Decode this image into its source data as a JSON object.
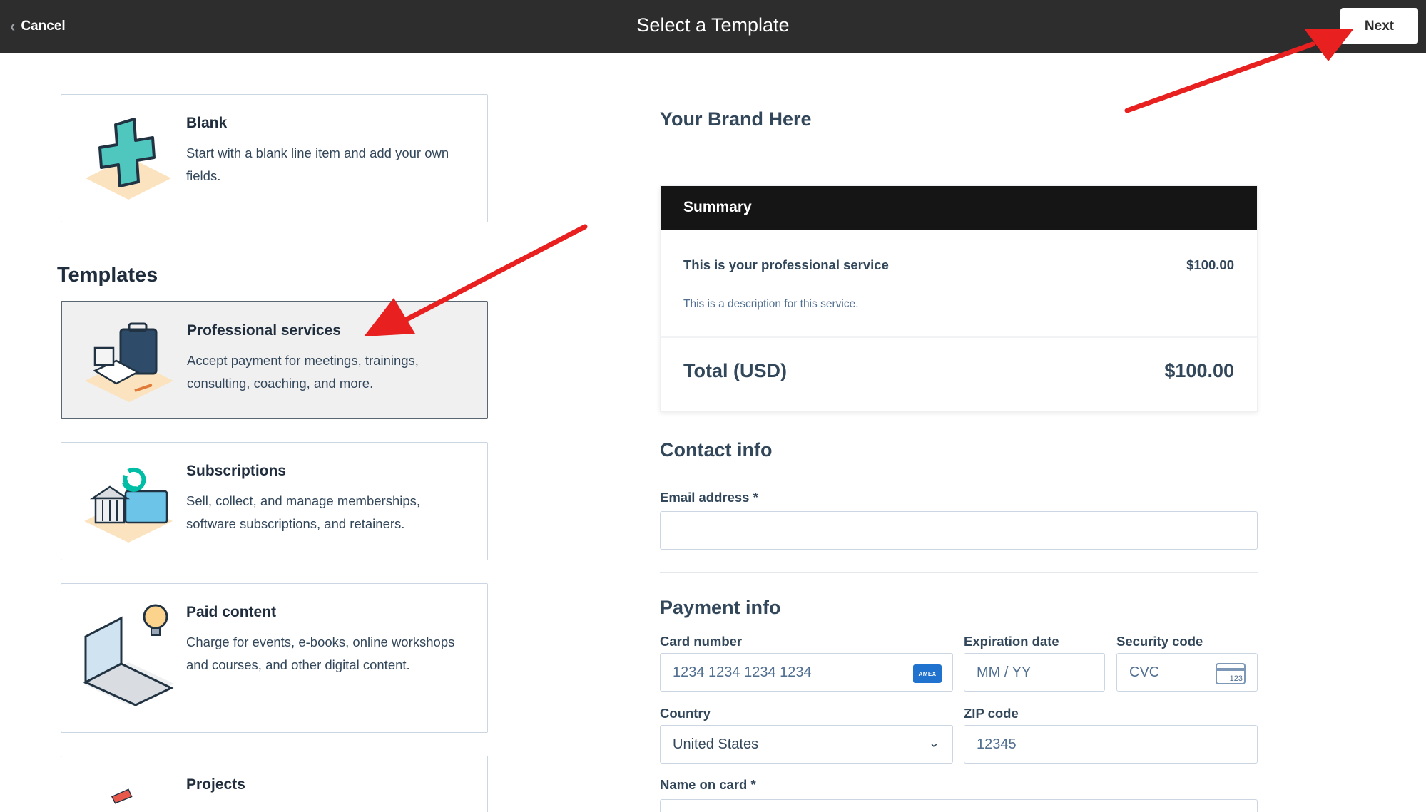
{
  "topbar": {
    "cancel_label": "Cancel",
    "title": "Select a Template",
    "next_label": "Next"
  },
  "blank_card": {
    "title": "Blank",
    "description": "Start with a blank line item and add your own fields."
  },
  "templates_heading": "Templates",
  "templates": [
    {
      "title": "Professional services",
      "description": "Accept payment for meetings, trainings, consulting, coaching, and more.",
      "selected": true
    },
    {
      "title": "Subscriptions",
      "description": "Sell, collect, and manage memberships, software subscriptions, and retainers.",
      "selected": false
    },
    {
      "title": "Paid content",
      "description": "Charge for events, e-books, online workshops and courses, and other digital content.",
      "selected": false
    },
    {
      "title": "Projects",
      "description": "",
      "selected": false
    }
  ],
  "preview": {
    "brand": "Your Brand Here",
    "summary": {
      "heading": "Summary",
      "item_name": "This is your professional service",
      "item_price": "$100.00",
      "item_description": "This is a description for this service.",
      "total_label": "Total (USD)",
      "total_value": "$100.00"
    },
    "contact": {
      "heading": "Contact info",
      "email_label": "Email address *"
    },
    "payment": {
      "heading": "Payment info",
      "card_label": "Card number",
      "card_placeholder": "1234 1234 1234 1234",
      "card_brand": "AMEX",
      "exp_label": "Expiration date",
      "exp_placeholder": "MM / YY",
      "cvc_label": "Security code",
      "cvc_placeholder": "CVC",
      "cvc_icon_text": "123",
      "country_label": "Country",
      "country_value": "United States",
      "zip_label": "ZIP code",
      "zip_value": "12345",
      "name_label": "Name on card *"
    }
  },
  "colors": {
    "topbar": "#2d2d2d",
    "annotation_arrow": "#e8201f",
    "summary_header": "#151515"
  }
}
